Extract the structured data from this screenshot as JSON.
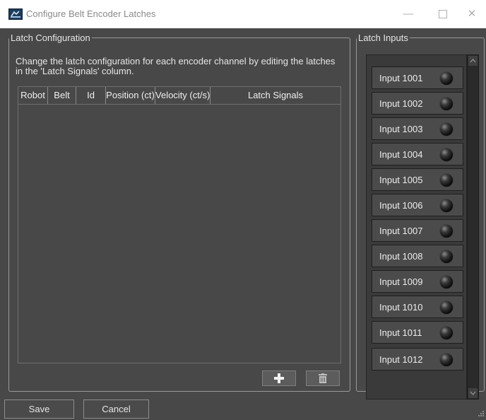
{
  "window": {
    "title": "Configure Belt Encoder Latches",
    "minimize_glyph": "—",
    "close_glyph": "✕"
  },
  "latch_config": {
    "legend": "Latch Configuration",
    "description": "Change the latch configuration for each encoder channel by editing the latches in the 'Latch Signals' column.",
    "columns": [
      "Robot",
      "Belt",
      "Id",
      "Position (ct)",
      "Velocity (ct/s)",
      "Latch Signals"
    ],
    "rows": [],
    "add_icon": "plus-icon",
    "delete_icon": "trash-icon"
  },
  "latch_inputs": {
    "legend": "Latch Inputs",
    "items": [
      {
        "label": "Input 1001"
      },
      {
        "label": "Input 1002"
      },
      {
        "label": "Input 1003"
      },
      {
        "label": "Input 1004"
      },
      {
        "label": "Input 1005"
      },
      {
        "label": "Input 1006"
      },
      {
        "label": "Input 1007"
      },
      {
        "label": "Input 1008"
      },
      {
        "label": "Input 1009"
      },
      {
        "label": "Input 1010"
      },
      {
        "label": "Input 1011"
      },
      {
        "label": "Input 1012"
      }
    ]
  },
  "footer": {
    "save_label": "Save",
    "cancel_label": "Cancel"
  }
}
